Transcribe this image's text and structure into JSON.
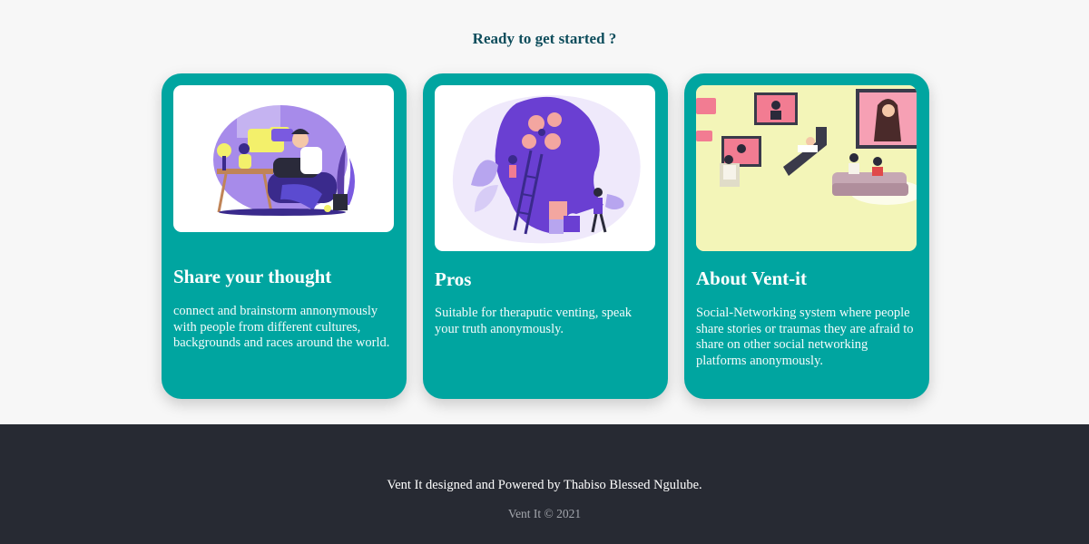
{
  "heading": "Ready to get started ?",
  "cards": [
    {
      "title": "Share your thought",
      "description": "connect and brainstorm annonymously with people from different cultures, backgrounds and races around the world.",
      "illustration": "person-relaxing-illustration"
    },
    {
      "title": "Pros",
      "description": "Suitable for theraputic venting, speak your truth anonymously.",
      "illustration": "brain-puzzle-illustration"
    },
    {
      "title": "About Vent-it",
      "description": "Social-Networking system where people share stories or traumas they are afraid to share on other social networking platforms anonymously.",
      "illustration": "social-network-illustration"
    }
  ],
  "footer": {
    "credit": "Vent It designed and Powered by Thabiso Blessed Ngulube.",
    "copyright": "Vent It © 2021"
  },
  "colors": {
    "background": "#f7f7f7",
    "heading": "#0e4d5c",
    "card": "#00a5a0",
    "footer": "#272a33"
  }
}
